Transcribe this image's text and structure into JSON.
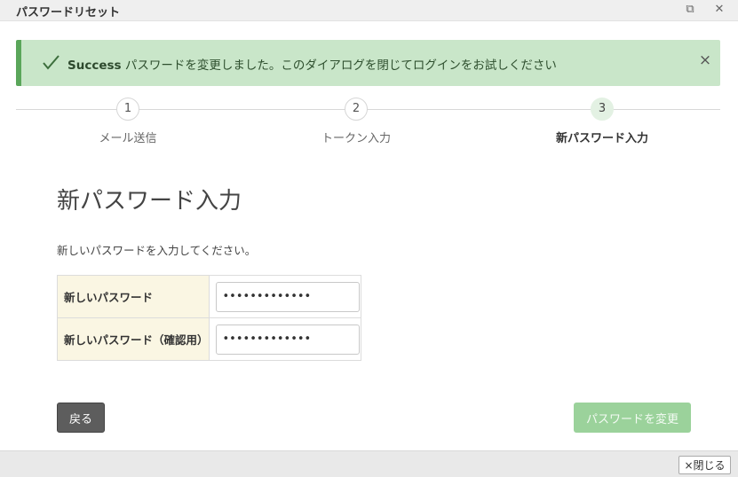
{
  "window": {
    "title": "パスワードリセット",
    "maximize_glyph": "⧉",
    "close_glyph": "✕"
  },
  "alert": {
    "strong": "Success",
    "message": " パスワードを変更しました。このダイアログを閉じてログインをお試しください",
    "close_glyph": "×",
    "check_color": "#3c6e3c"
  },
  "steps": [
    {
      "number": "1",
      "label": "メール送信"
    },
    {
      "number": "2",
      "label": "トークン入力"
    },
    {
      "number": "3",
      "label": "新パスワード入力",
      "active": true
    }
  ],
  "main": {
    "heading": "新パスワード入力",
    "description": "新しいパスワードを入力してください。"
  },
  "form": {
    "new_password_label": "新しいパスワード",
    "new_password_value": "password12345",
    "confirm_password_label": "新しいパスワード（確認用）",
    "confirm_password_value": "password12345"
  },
  "buttons": {
    "back": "戻る",
    "submit": "パスワードを変更",
    "close": "×閉じる"
  }
}
